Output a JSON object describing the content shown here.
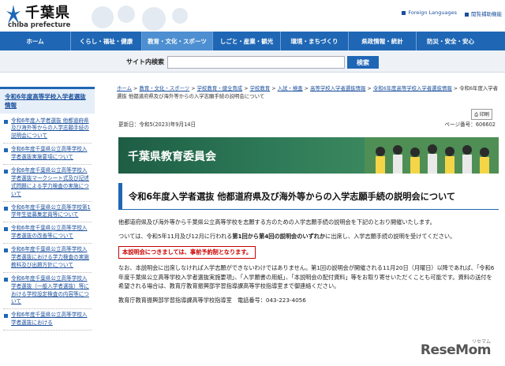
{
  "header": {
    "logo_ja": "千葉県",
    "logo_en": "chiba prefecture",
    "links": [
      "Foreign Languages",
      "閲覧補助機能"
    ]
  },
  "nav": {
    "items": [
      "ホーム",
      "くらし・福祉・健康",
      "教育・文化・スポーツ",
      "しごと・産業・観光",
      "環境・まちづくり",
      "県政情報・統計",
      "防災・安全・安心"
    ]
  },
  "search": {
    "label": "サイト内検索",
    "value": "",
    "button": "検索"
  },
  "sidebar": {
    "heading": "令和6年度高等学校入学者選抜情報",
    "items": [
      "令和6年度入学者選抜 他都道府県及び海外等からの入学志願手続の説明会について",
      "令和6年度千葉県公立高等学校入学者選抜実施要項について",
      "令和6年度千葉県公立高等学校入学者選抜マークシート式及び記述式問題による学力検査の実施について",
      "令和6年度千葉県公立高等学校第1学年生徒募集定員等について",
      "令和6年度千葉県公立高等学校入学者選抜の改善等について",
      "令和6年度千葉県公立高等学校入学者選抜における学力検査の実施教科及び出題方針について",
      "令和6年度千葉県公立高等学校入学者選抜（一般入学者選抜）等における学校設定検査の内容等について",
      "令和6年度千葉県公立高等学校入学者選抜における"
    ]
  },
  "breadcrumb": {
    "items": [
      "ホーム",
      "教育・文化・スポーツ",
      "学校教育・健全育成",
      "学校教育",
      "入試・検査",
      "高等学校入学者選抜情報",
      "令和6年度高等学校入学者選抜情報"
    ],
    "separator": ">",
    "current": "令和6年度入学者選抜 他都道府県及び海外等からの入学志願手続の説明会について"
  },
  "print_label": "印刷",
  "meta": {
    "updated": "更新日：令和5(2023)年9月14日",
    "page_no": "ページ番号：606602"
  },
  "banner_title": "千葉県教育委員会",
  "page_title": "令和6年度入学者選抜 他都道府県及び海外等からの入学志願手続の説明会について",
  "content": {
    "p1": "他都道府県及び海外等から千葉県公立高等学校を志願する方のための入学志願手続の説明会を下記のとおり開催いたします。",
    "p2_a": "ついては、令和5年11月及び12月に行われる",
    "p2_b": "第1回から第4回の説明会のいずれか",
    "p2_c": "に出席し、入学志願手続の説明を受けてください。",
    "notice": "本説明会につきましては、事前予約制となります。",
    "p3": "なお、本説明会に出席しなければ入学志願ができないわけではありません。第1回の説明会が開催される11月20日（月曜日）以降であれば、「令和6年度千葉県公立高等学校入学者選抜実施要項」、「入学願書の用紙」、「本説明会の配付資料」等をお取り寄せいただくことも可能です。資料の送付を希望される場合は、教育庁教育振興部学習指導課高等学校指導室まで御連絡ください。",
    "contact": "教育庁教育振興部学習指導課高等学校指導室　電話番号：043-223-4056"
  },
  "watermark": {
    "text": "ReseMom",
    "sub": "リセマム"
  }
}
